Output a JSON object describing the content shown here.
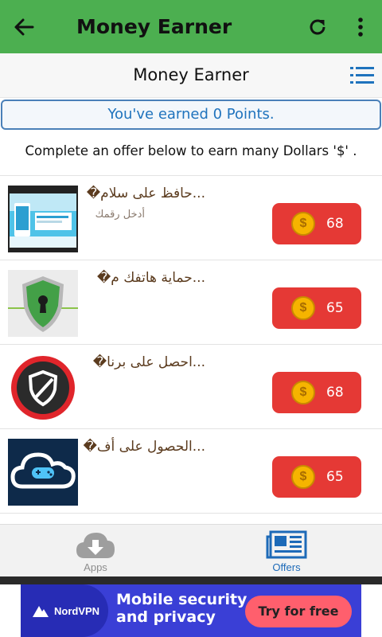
{
  "app_bar": {
    "title": "Money Earner",
    "back_icon": "arrow-left-icon",
    "refresh_icon": "refresh-icon",
    "menu_icon": "more-vertical-icon",
    "color": "#4caf50"
  },
  "sub_header": {
    "title": "Money Earner",
    "list_icon": "list-icon"
  },
  "points_banner": {
    "text": "You've earned 0 Points."
  },
  "instruction": "Complete an offer below to earn many Dollars '$' .",
  "offers": [
    {
      "name": "...حافظ على سلام�",
      "description": "أدخل رقمك",
      "points": "68",
      "coin_symbol": "$",
      "thumb_icon": "phone-clean-app-icon"
    },
    {
      "name": "...حماية هاتفك م�",
      "description": "",
      "points": "65",
      "coin_symbol": "$",
      "thumb_icon": "security-shield-icon"
    },
    {
      "name": "...احصل على برنا�",
      "description": "",
      "points": "68",
      "coin_symbol": "$",
      "thumb_icon": "antivirus-shield-icon"
    },
    {
      "name": "...الحصول على أف�",
      "description": "",
      "points": "65",
      "coin_symbol": "$",
      "thumb_icon": "cloud-gamepad-icon"
    }
  ],
  "bottom_nav": [
    {
      "label": "Apps",
      "icon": "cloud-download-icon",
      "active": false
    },
    {
      "label": "Offers",
      "icon": "newspaper-icon",
      "active": true
    }
  ],
  "ad_banner": {
    "brand": "NordVPN",
    "headline_line1": "Mobile security",
    "headline_line2": "and privacy",
    "cta": "Try for free"
  },
  "colors": {
    "accent_blue": "#1f73bd",
    "earn_red": "#e53935",
    "coin_gold": "#f6b400",
    "offer_name": "#5b3b1e"
  }
}
